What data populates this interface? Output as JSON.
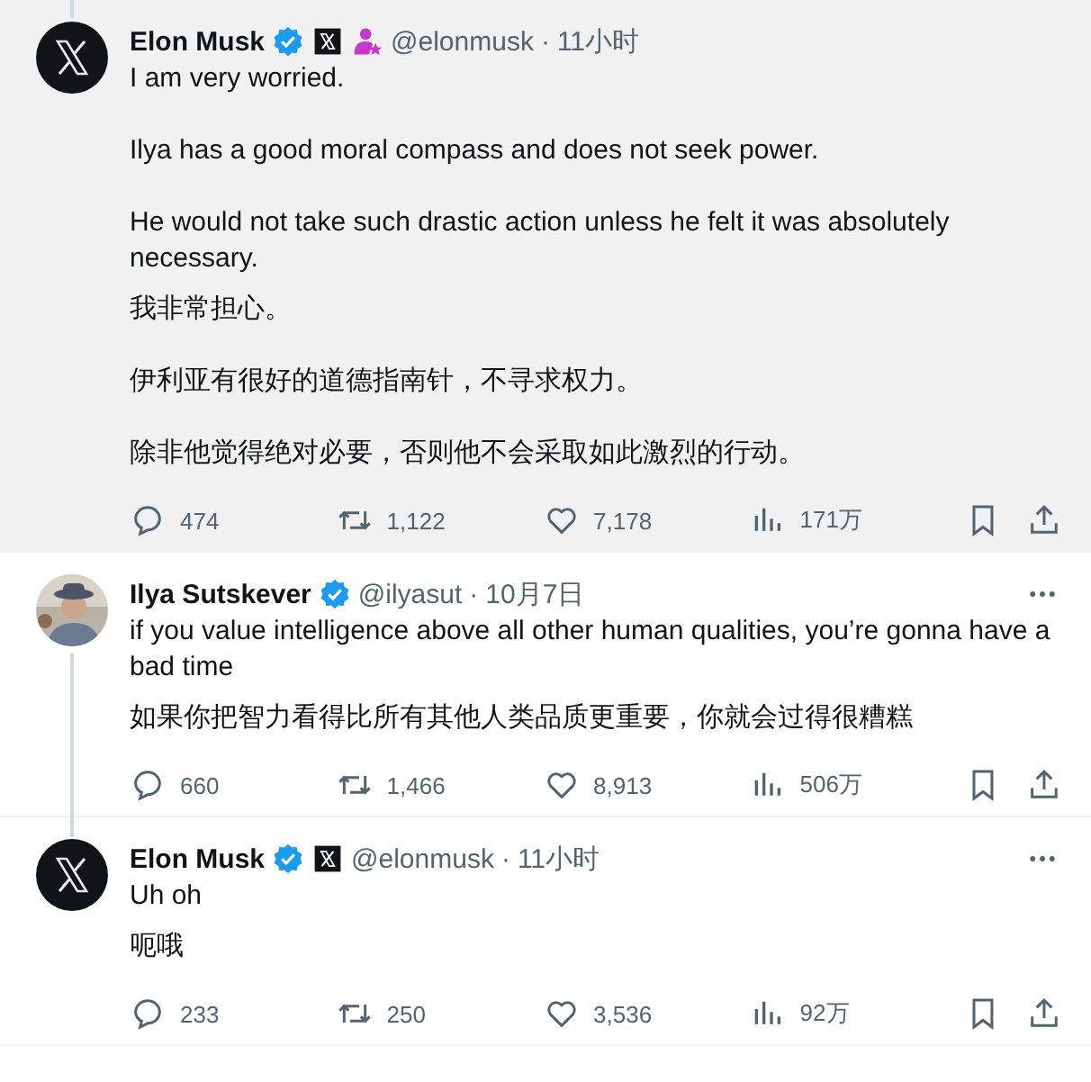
{
  "tweets": [
    {
      "highlighted": true,
      "avatar": {
        "kind": "logo"
      },
      "thread_above": true,
      "thread_below": false,
      "name": "Elon Musk",
      "badges": [
        {
          "kind": "verified"
        },
        {
          "kind": "affiliate"
        },
        {
          "kind": "manager"
        }
      ],
      "handle": "@elonmusk",
      "separator": "·",
      "time": "11小时",
      "more": false,
      "blocks": [
        [
          "I am very worried.",
          "Ilya has a good moral compass and does not seek power.",
          "He would not take such drastic action unless he felt it was absolutely necessary."
        ],
        [
          "我非常担心。",
          "伊利亚有很好的道德指南针，不寻求权力。",
          "除非他觉得绝对必要，否则他不会采取如此激烈的行动。"
        ]
      ],
      "stats": {
        "replies": "474",
        "reposts": "1,122",
        "likes": "7,178",
        "views": "171万"
      }
    },
    {
      "highlighted": false,
      "avatar": {
        "kind": "person"
      },
      "thread_above": false,
      "thread_below": true,
      "name": "Ilya Sutskever",
      "badges": [
        {
          "kind": "verified"
        }
      ],
      "handle": "@ilyasut",
      "separator": "·",
      "time": "10月7日",
      "more": true,
      "blocks": [
        [
          "if you value intelligence above all other human qualities, you’re gonna have a bad time"
        ],
        [
          "如果你把智力看得比所有其他人类品质更重要，你就会过得很糟糕"
        ]
      ],
      "stats": {
        "replies": "660",
        "reposts": "1,466",
        "likes": "8,913",
        "views": "506万"
      }
    },
    {
      "highlighted": false,
      "avatar": {
        "kind": "logo"
      },
      "thread_above": false,
      "thread_below": false,
      "name": "Elon Musk",
      "badges": [
        {
          "kind": "verified"
        },
        {
          "kind": "affiliate"
        }
      ],
      "handle": "@elonmusk",
      "separator": "·",
      "time": "11小时",
      "more": true,
      "blocks": [
        [
          "Uh oh"
        ],
        [
          "呃哦"
        ]
      ],
      "stats": {
        "replies": "233",
        "reposts": "250",
        "likes": "3,536",
        "views": "92万"
      }
    }
  ]
}
